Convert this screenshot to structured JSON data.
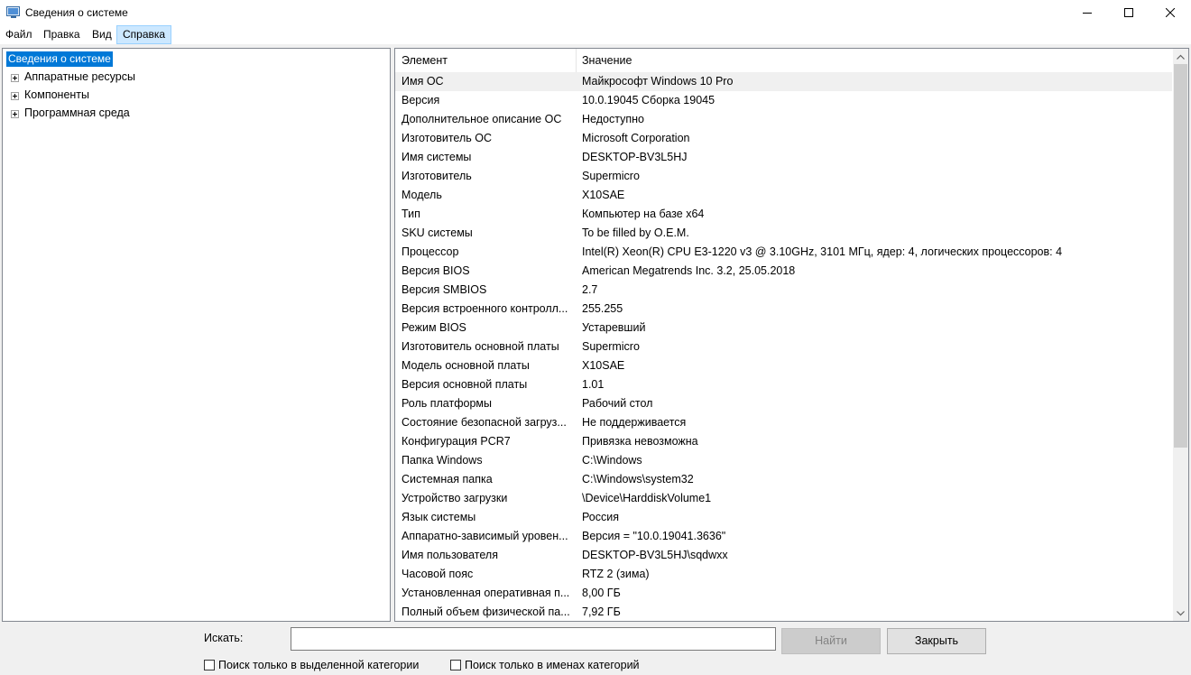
{
  "window": {
    "title": "Сведения о системе",
    "icon": "system-info-app-icon"
  },
  "menu": [
    "Файл",
    "Правка",
    "Вид",
    "Справка"
  ],
  "tree": {
    "root": "Сведения о системе",
    "children": [
      "Аппаратные ресурсы",
      "Компоненты",
      "Программная среда"
    ]
  },
  "list": {
    "headers": {
      "name": "Элемент",
      "value": "Значение"
    },
    "rows": [
      {
        "name": "Имя ОС",
        "value": "Майкрософт Windows 10 Pro"
      },
      {
        "name": "Версия",
        "value": "10.0.19045 Сборка 19045"
      },
      {
        "name": "Дополнительное описание ОС",
        "value": "Недоступно"
      },
      {
        "name": "Изготовитель ОС",
        "value": "Microsoft Corporation"
      },
      {
        "name": "Имя системы",
        "value": "DESKTOP-BV3L5HJ"
      },
      {
        "name": "Изготовитель",
        "value": "Supermicro"
      },
      {
        "name": "Модель",
        "value": "X10SAE"
      },
      {
        "name": "Тип",
        "value": "Компьютер на базе x64"
      },
      {
        "name": "SKU системы",
        "value": "To be filled by O.E.M."
      },
      {
        "name": "Процессор",
        "value": "Intel(R) Xeon(R) CPU E3-1220 v3 @ 3.10GHz, 3101 МГц, ядер: 4, логических процессоров: 4"
      },
      {
        "name": "Версия BIOS",
        "value": "American Megatrends Inc. 3.2, 25.05.2018"
      },
      {
        "name": "Версия SMBIOS",
        "value": "2.7"
      },
      {
        "name": "Версия встроенного контролл...",
        "value": "255.255"
      },
      {
        "name": "Режим BIOS",
        "value": "Устаревший"
      },
      {
        "name": "Изготовитель основной платы",
        "value": "Supermicro"
      },
      {
        "name": "Модель основной платы",
        "value": "X10SAE"
      },
      {
        "name": "Версия основной платы",
        "value": "1.01"
      },
      {
        "name": "Роль платформы",
        "value": "Рабочий стол"
      },
      {
        "name": "Состояние безопасной загруз...",
        "value": "Не поддерживается"
      },
      {
        "name": "Конфигурация PCR7",
        "value": "Привязка невозможна"
      },
      {
        "name": "Папка Windows",
        "value": "C:\\Windows"
      },
      {
        "name": "Системная папка",
        "value": "C:\\Windows\\system32"
      },
      {
        "name": "Устройство загрузки",
        "value": "\\Device\\HarddiskVolume1"
      },
      {
        "name": "Язык системы",
        "value": "Россия"
      },
      {
        "name": "Аппаратно-зависимый уровен...",
        "value": "Версия = \"10.0.19041.3636\""
      },
      {
        "name": "Имя пользователя",
        "value": "DESKTOP-BV3L5HJ\\sqdwxx"
      },
      {
        "name": "Часовой пояс",
        "value": "RTZ 2 (зима)"
      },
      {
        "name": "Установленная оперативная п...",
        "value": "8,00 ГБ"
      },
      {
        "name": "Полный объем физической па...",
        "value": "7,92 ГБ"
      }
    ]
  },
  "search": {
    "label": "Искать:",
    "value": "",
    "find_button": "Найти",
    "close_button": "Закрыть",
    "option_selected_category": "Поиск только в выделенной категории",
    "option_category_names": "Поиск только в именах категорий"
  }
}
